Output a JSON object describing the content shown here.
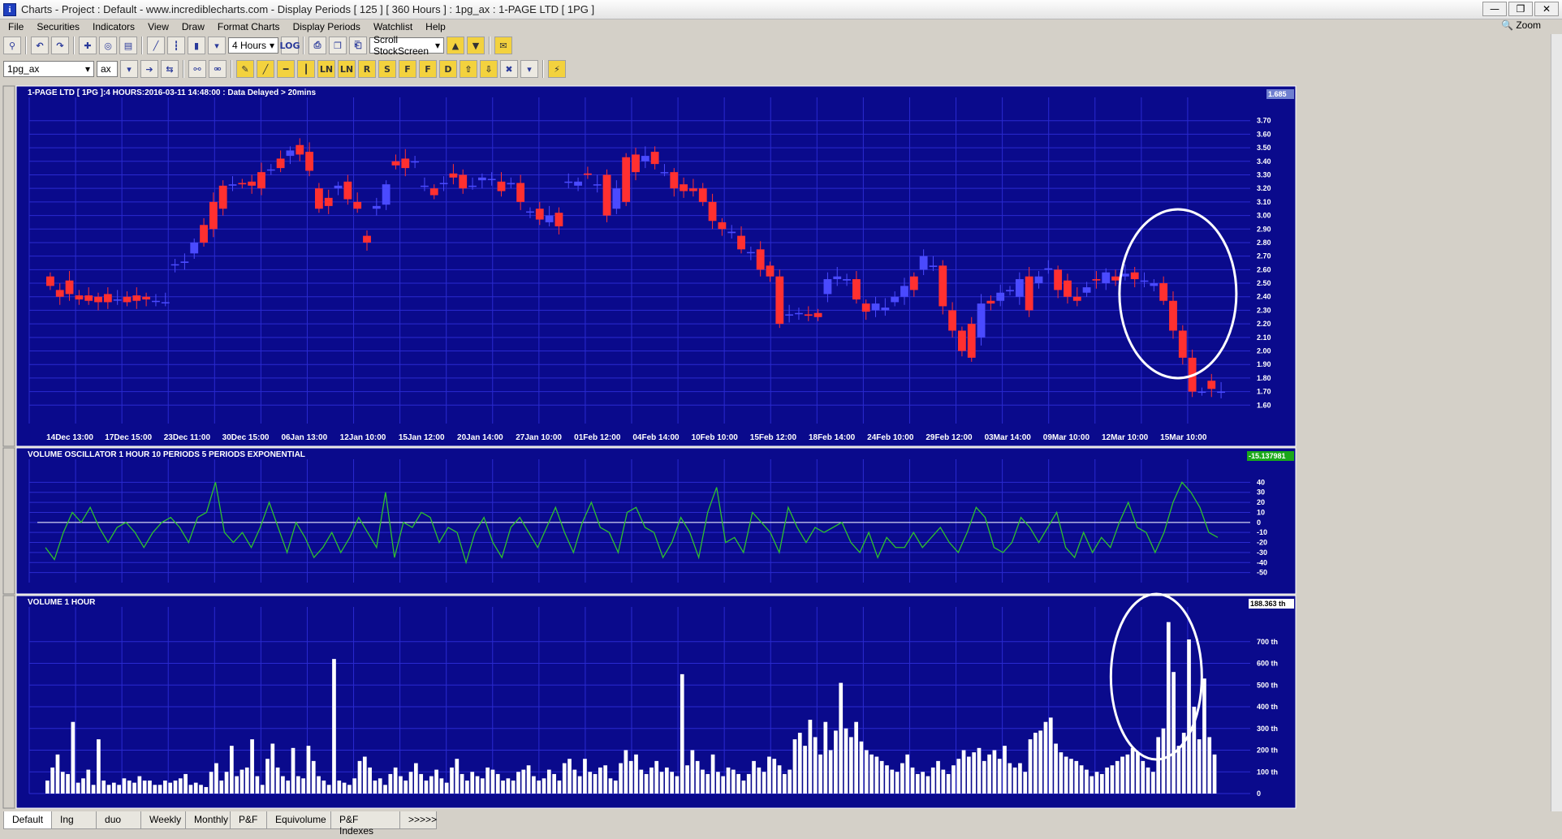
{
  "window": {
    "title": "Charts - Project : Default - www.incrediblecharts.com - Display Periods  [ 125 ]  [ 360 Hours ] : 1pg_ax : 1-PAGE LTD  [ 1PG ]",
    "min": "—",
    "max": "❐",
    "close": "✕"
  },
  "menu": [
    "File",
    "Securities",
    "Indicators",
    "View",
    "Draw",
    "Format Charts",
    "Display Periods",
    "Watchlist",
    "Help"
  ],
  "zoom_label": "Zoom",
  "toolbar": {
    "interval": "4 Hours",
    "scroll": "Scroll StockScreen",
    "log": "LOG",
    "watchlist": "1pg_ax",
    "prefix": "ax",
    "line_tools": [
      "LN",
      "LN",
      "R",
      "S",
      "F",
      "F",
      "D"
    ]
  },
  "tabs": [
    "Default",
    "Ing",
    "duo",
    "Weekly",
    "Monthly",
    "P&F",
    "Equivolume",
    "P&F Indexes",
    ">>>>>"
  ],
  "colors": {
    "panel_bg": "#0a0a8c",
    "grid": "#2a2ad0",
    "up": "#4a4aff",
    "down": "#ff3030",
    "osc": "#2ec02e",
    "vol": "#ffffff",
    "text": "#ffffff"
  },
  "chart_data": [
    {
      "type": "candlestick",
      "title": "1-PAGE LTD [ 1PG ]:4 HOURS:2016-03-11 14:48:00 : Data Delayed > 20mins",
      "last_value_tag": "1.685",
      "ylim": [
        1.5,
        3.8
      ],
      "yticks": [
        "3.70",
        "3.60",
        "3.50",
        "3.40",
        "3.30",
        "3.20",
        "3.10",
        "3.00",
        "2.90",
        "2.80",
        "2.70",
        "2.60",
        "2.50",
        "2.40",
        "2.30",
        "2.20",
        "2.10",
        "2.00",
        "1.90",
        "1.80",
        "1.70",
        "1.60"
      ],
      "x_labels": [
        "14Dec 13:00",
        "17Dec 15:00",
        "23Dec 11:00",
        "30Dec 15:00",
        "06Jan 13:00",
        "12Jan 10:00",
        "15Jan 12:00",
        "20Jan 14:00",
        "27Jan 10:00",
        "01Feb 12:00",
        "04Feb 14:00",
        "10Feb 10:00",
        "15Feb 12:00",
        "18Feb 14:00",
        "24Feb 10:00",
        "29Feb 12:00",
        "03Mar 14:00",
        "09Mar 10:00",
        "12Mar 10:00",
        "15Mar 10:00"
      ],
      "candles": [
        [
          2.55,
          2.48
        ],
        [
          2.45,
          2.4
        ],
        [
          2.52,
          2.42
        ],
        [
          2.41,
          2.38
        ],
        [
          2.41,
          2.37
        ],
        [
          2.4,
          2.36
        ],
        [
          2.42,
          2.36
        ],
        [
          2.38,
          2.38
        ],
        [
          2.4,
          2.36
        ],
        [
          2.41,
          2.37
        ],
        [
          2.4,
          2.38
        ],
        [
          2.37,
          2.37
        ],
        [
          2.36,
          2.36
        ],
        [
          2.64,
          2.64
        ],
        [
          2.65,
          2.66
        ],
        [
          2.72,
          2.8
        ],
        [
          2.93,
          2.8
        ],
        [
          3.1,
          2.9
        ],
        [
          3.22,
          3.05
        ],
        [
          3.22,
          3.23
        ],
        [
          3.24,
          3.23
        ],
        [
          3.25,
          3.22
        ],
        [
          3.32,
          3.2
        ],
        [
          3.34,
          3.34
        ],
        [
          3.42,
          3.35
        ],
        [
          3.44,
          3.48
        ],
        [
          3.52,
          3.45
        ],
        [
          3.47,
          3.33
        ],
        [
          3.2,
          3.05
        ],
        [
          3.13,
          3.07
        ],
        [
          3.2,
          3.22
        ],
        [
          3.25,
          3.12
        ],
        [
          3.1,
          3.05
        ],
        [
          2.85,
          2.8
        ],
        [
          3.05,
          3.07
        ],
        [
          3.08,
          3.23
        ],
        [
          3.4,
          3.37
        ],
        [
          3.42,
          3.35
        ],
        [
          3.4,
          3.4
        ],
        [
          3.22,
          3.22
        ],
        [
          3.2,
          3.15
        ],
        [
          3.24,
          3.24
        ],
        [
          3.31,
          3.28
        ],
        [
          3.3,
          3.2
        ],
        [
          3.22,
          3.22
        ],
        [
          3.26,
          3.28
        ],
        [
          3.27,
          3.27
        ],
        [
          3.25,
          3.18
        ],
        [
          3.23,
          3.24
        ],
        [
          3.24,
          3.1
        ],
        [
          3.03,
          3.03
        ],
        [
          3.05,
          2.97
        ],
        [
          2.95,
          3.0
        ],
        [
          3.02,
          2.92
        ],
        [
          3.25,
          3.25
        ],
        [
          3.22,
          3.25
        ],
        [
          3.31,
          3.3
        ],
        [
          3.23,
          3.23
        ],
        [
          3.3,
          3.0
        ],
        [
          3.05,
          3.2
        ],
        [
          3.43,
          3.1
        ],
        [
          3.45,
          3.32
        ],
        [
          3.4,
          3.44
        ],
        [
          3.47,
          3.38
        ],
        [
          3.32,
          3.32
        ],
        [
          3.32,
          3.2
        ],
        [
          3.23,
          3.18
        ],
        [
          3.2,
          3.18
        ],
        [
          3.2,
          3.1
        ],
        [
          3.1,
          2.96
        ],
        [
          2.95,
          2.9
        ],
        [
          2.87,
          2.88
        ],
        [
          2.85,
          2.75
        ],
        [
          2.73,
          2.73
        ],
        [
          2.75,
          2.6
        ],
        [
          2.63,
          2.55
        ],
        [
          2.55,
          2.2
        ],
        [
          2.27,
          2.27
        ],
        [
          2.28,
          2.28
        ],
        [
          2.27,
          2.26
        ],
        [
          2.28,
          2.25
        ],
        [
          2.42,
          2.53
        ],
        [
          2.53,
          2.55
        ],
        [
          2.52,
          2.53
        ],
        [
          2.53,
          2.38
        ],
        [
          2.35,
          2.29
        ],
        [
          2.3,
          2.35
        ],
        [
          2.3,
          2.32
        ],
        [
          2.36,
          2.4
        ],
        [
          2.4,
          2.48
        ],
        [
          2.55,
          2.45
        ],
        [
          2.6,
          2.7
        ],
        [
          2.62,
          2.63
        ],
        [
          2.63,
          2.33
        ],
        [
          2.3,
          2.15
        ],
        [
          2.15,
          2.0
        ],
        [
          2.2,
          1.95
        ],
        [
          2.1,
          2.35
        ],
        [
          2.37,
          2.35
        ],
        [
          2.37,
          2.43
        ],
        [
          2.44,
          2.45
        ],
        [
          2.4,
          2.53
        ],
        [
          2.55,
          2.3
        ],
        [
          2.5,
          2.55
        ],
        [
          2.6,
          2.61
        ],
        [
          2.6,
          2.45
        ],
        [
          2.52,
          2.4
        ],
        [
          2.4,
          2.37
        ],
        [
          2.43,
          2.47
        ],
        [
          2.53,
          2.52
        ],
        [
          2.5,
          2.58
        ],
        [
          2.55,
          2.52
        ],
        [
          2.55,
          2.57
        ],
        [
          2.58,
          2.53
        ],
        [
          2.52,
          2.52
        ],
        [
          2.48,
          2.5
        ],
        [
          2.5,
          2.37
        ],
        [
          2.37,
          2.15
        ],
        [
          2.15,
          1.95
        ],
        [
          1.95,
          1.7
        ],
        [
          1.7,
          1.7
        ],
        [
          1.78,
          1.72
        ],
        [
          1.7,
          1.7
        ]
      ]
    },
    {
      "type": "line",
      "title": "VOLUME OSCILLATOR 1 HOUR 10 PERIODS 5 PERIODS EXPONENTIAL",
      "last_value_tag": "-15.137981",
      "ylim": [
        -60,
        50
      ],
      "yticks": [
        "40",
        "30",
        "20",
        "10",
        "0",
        "-10",
        "-20",
        "-30",
        "-40",
        "-50"
      ],
      "series": [
        {
          "values": [
            -25,
            -37,
            -10,
            10,
            0,
            15,
            -5,
            -20,
            -5,
            0,
            -10,
            -25,
            -10,
            0,
            5,
            -5,
            -20,
            5,
            10,
            40,
            -10,
            -20,
            -10,
            -25,
            -5,
            20,
            -5,
            -30,
            0,
            -15,
            -35,
            -25,
            -10,
            -30,
            -15,
            5,
            -10,
            -25,
            30,
            -35,
            0,
            -5,
            10,
            5,
            -20,
            -5,
            -10,
            -40,
            -10,
            5,
            -20,
            -35,
            -5,
            5,
            -10,
            -25,
            -5,
            15,
            -10,
            -30,
            0,
            20,
            -5,
            -10,
            -30,
            10,
            15,
            -5,
            -10,
            -35,
            -20,
            5,
            -10,
            -35,
            10,
            35,
            -20,
            -15,
            -30,
            10,
            0,
            -10,
            -30,
            15,
            -5,
            -20,
            -5,
            -10,
            -5,
            0,
            -20,
            -30,
            -10,
            -35,
            -15,
            -25,
            -25,
            -10,
            -25,
            -15,
            -5,
            -20,
            -30,
            -10,
            15,
            5,
            -25,
            -30,
            -20,
            5,
            -5,
            -20,
            -5,
            10,
            -25,
            -35,
            -10,
            -30,
            -15,
            -25,
            0,
            20,
            -5,
            -10,
            -30,
            -10,
            20,
            40,
            30,
            15,
            -10,
            -15
          ]
        }
      ]
    },
    {
      "type": "bar",
      "title": "VOLUME 1 HOUR",
      "last_value_tag": "188.363 th",
      "ylim": [
        0,
        800
      ],
      "yticks": [
        "700 th",
        "600 th",
        "500 th",
        "400 th",
        "300 th",
        "200 th",
        "100 th",
        "0"
      ],
      "values": [
        60,
        120,
        180,
        100,
        90,
        330,
        50,
        70,
        110,
        40,
        250,
        60,
        40,
        50,
        40,
        70,
        60,
        50,
        80,
        60,
        60,
        40,
        40,
        60,
        50,
        60,
        70,
        90,
        40,
        50,
        40,
        30,
        100,
        140,
        60,
        100,
        220,
        80,
        110,
        120,
        250,
        80,
        40,
        160,
        230,
        120,
        80,
        60,
        210,
        80,
        70,
        220,
        150,
        80,
        60,
        40,
        620,
        60,
        50,
        40,
        70,
        150,
        170,
        120,
        60,
        70,
        40,
        90,
        120,
        80,
        60,
        100,
        140,
        90,
        60,
        80,
        110,
        70,
        50,
        120,
        160,
        90,
        60,
        100,
        80,
        70,
        120,
        110,
        90,
        60,
        70,
        60,
        100,
        110,
        130,
        80,
        60,
        70,
        110,
        90,
        60,
        140,
        160,
        110,
        80,
        160,
        100,
        90,
        120,
        130,
        70,
        60,
        140,
        200,
        150,
        180,
        110,
        90,
        120,
        150,
        100,
        120,
        100,
        80,
        550,
        130,
        200,
        150,
        110,
        90,
        180,
        100,
        80,
        120,
        110,
        90,
        60,
        90,
        150,
        120,
        100,
        170,
        160,
        130,
        90,
        110,
        250,
        280,
        220,
        340,
        260,
        180,
        330,
        200,
        290,
        510,
        300,
        260,
        330,
        240,
        200,
        180,
        170,
        150,
        130,
        110,
        100,
        140,
        180,
        120,
        90,
        100,
        80,
        120,
        150,
        110,
        90,
        130,
        160,
        200,
        170,
        190,
        210,
        150,
        180,
        200,
        160,
        220,
        140,
        120,
        140,
        100,
        250,
        280,
        290,
        330,
        350,
        230,
        190,
        170,
        160,
        150,
        130,
        110,
        80,
        100,
        90,
        120,
        130,
        150,
        170,
        180,
        210,
        190,
        150,
        120,
        100,
        260,
        300,
        790,
        560,
        220,
        280,
        710,
        400,
        250,
        530,
        260,
        180
      ]
    }
  ]
}
